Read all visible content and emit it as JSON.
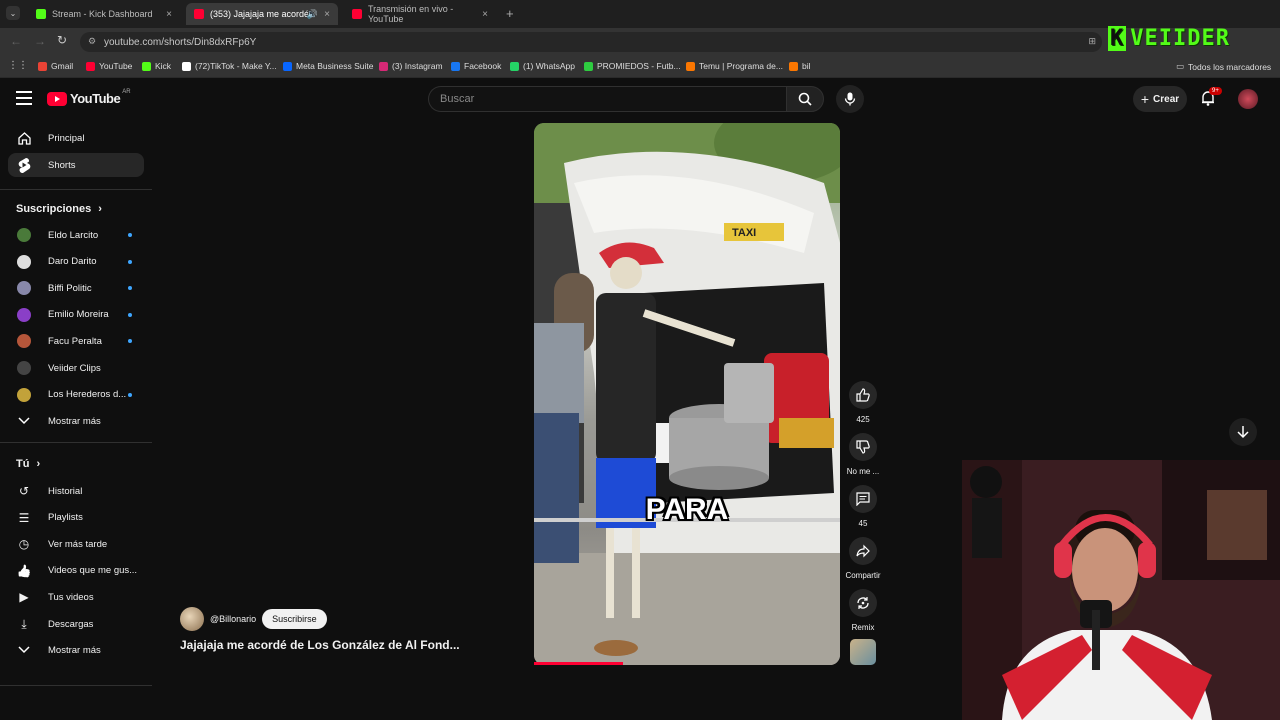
{
  "browser": {
    "tabs": [
      {
        "title": "Stream - Kick Dashboard",
        "favicon_color": "#53fc18"
      },
      {
        "title": "(353) Jajajaja me acordé de",
        "favicon_color": "#ff0033"
      },
      {
        "title": "Transmisión en vivo - YouTube",
        "favicon_color": "#ff0033"
      }
    ],
    "new_tab": "+",
    "close": "×",
    "url": "youtube.com/shorts/Din8dxRFp6Y",
    "bookmarks": [
      {
        "label": "Gmail",
        "color": "#ea4335"
      },
      {
        "label": "YouTube",
        "color": "#ff0033"
      },
      {
        "label": "Kick",
        "color": "#53fc18"
      },
      {
        "label": "(72)TikTok - Make Y...",
        "color": "#ffffff"
      },
      {
        "label": "Meta Business Suite",
        "color": "#0866ff"
      },
      {
        "label": "(3) Instagram",
        "color": "#d62976"
      },
      {
        "label": "Facebook",
        "color": "#1877f2"
      },
      {
        "label": "(1) WhatsApp",
        "color": "#25d366"
      },
      {
        "label": "PROMIEDOS - Futb...",
        "color": "#2ecc40"
      },
      {
        "label": "Temu | Programa de...",
        "color": "#fb7701"
      },
      {
        "label": "bil",
        "color": "#fb7701"
      }
    ],
    "all_bookmarks": "Todos los marcadores"
  },
  "youtube": {
    "logo": "YouTube",
    "country": "AR",
    "search_placeholder": "Buscar",
    "create_label": "Crear",
    "notif_count": "9+"
  },
  "sidebar": {
    "main": [
      {
        "label": "Principal",
        "icon": "home-icon"
      },
      {
        "label": "Shorts",
        "icon": "shorts-icon"
      }
    ],
    "subscriptions_title": "Suscripciones",
    "subscriptions": [
      {
        "label": "Eldo Larcito",
        "color": "#4a7a3a"
      },
      {
        "label": "Daro Darito",
        "color": "#dddddd"
      },
      {
        "label": "Biffi Politic",
        "color": "#8888aa"
      },
      {
        "label": "Emilio Moreira",
        "color": "#8a3fc7"
      },
      {
        "label": "Facu Peralta",
        "color": "#b5563a"
      },
      {
        "label": "Veiider Clips",
        "color": "#444444"
      },
      {
        "label": "Los Herederos d...",
        "color": "#c2a23a"
      }
    ],
    "show_more": "Mostrar más",
    "you_title": "Tú",
    "you_items": [
      {
        "label": "Historial",
        "icon": "history-icon"
      },
      {
        "label": "Playlists",
        "icon": "playlist-icon"
      },
      {
        "label": "Ver más tarde",
        "icon": "clock-icon"
      },
      {
        "label": "Videos que me gus...",
        "icon": "thumbs-up-icon"
      },
      {
        "label": "Tus videos",
        "icon": "video-icon"
      },
      {
        "label": "Descargas",
        "icon": "download-icon"
      }
    ],
    "show_more_2": "Mostrar más"
  },
  "short": {
    "caption": "PARA",
    "taxi_sign": "TAXI",
    "channel": "@Billonario",
    "subscribe": "Suscribirse",
    "title": "Jajajaja me acordé de Los González de Al Fond...",
    "likes": "425",
    "dislike_label": "No me ...",
    "comments": "45",
    "share_label": "Compartir",
    "remix_label": "Remix",
    "progress": 0.29
  },
  "overlay": {
    "logo_text": "VEIIDER",
    "logo_k": "K"
  }
}
